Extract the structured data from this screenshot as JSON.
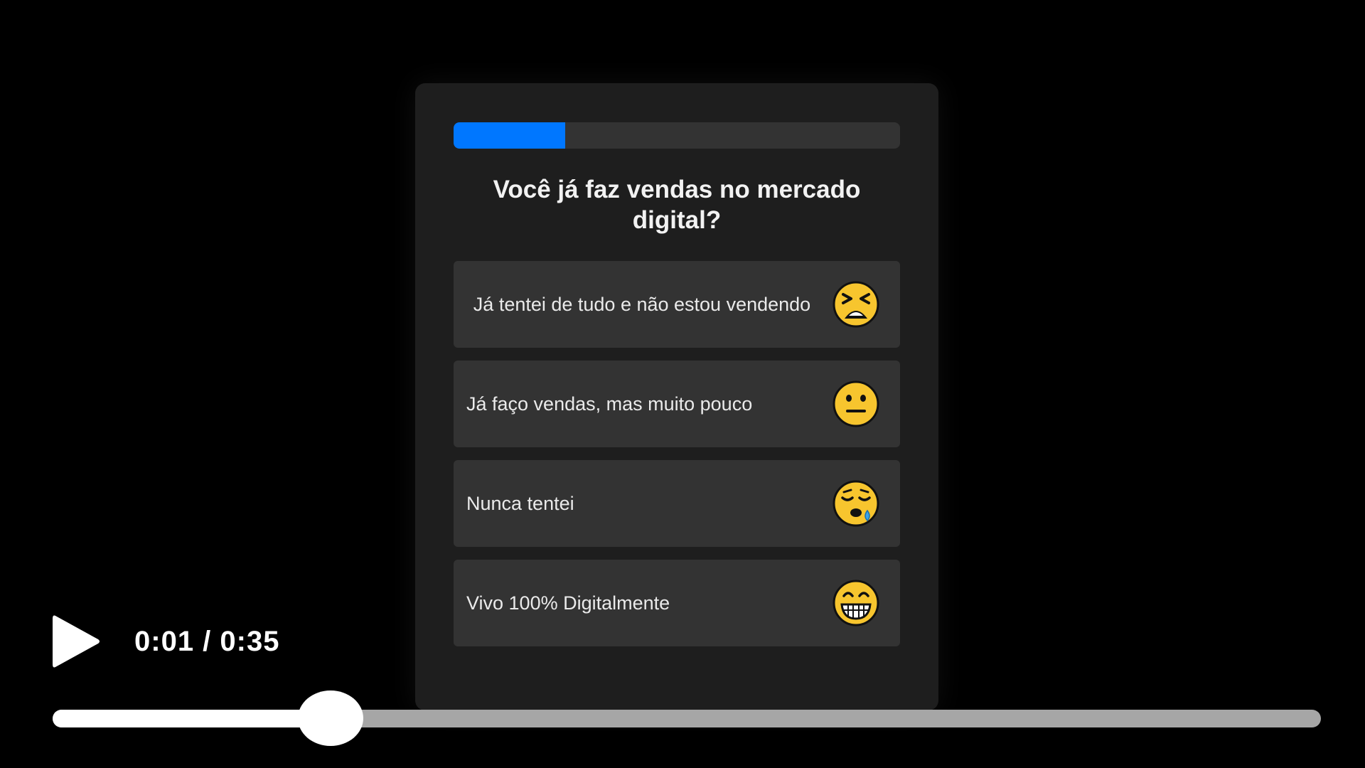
{
  "quiz": {
    "progress": 0.25,
    "progress_color": "#0077ff",
    "question": "Você já faz vendas no mercado digital?",
    "options": [
      {
        "label": "Já tentei de tudo e não estou vendendo",
        "icon": "tired-face-emoji-icon"
      },
      {
        "label": "Já faço vendas, mas muito pouco",
        "icon": "neutral-face-emoji-icon"
      },
      {
        "label": "Nunca tentei",
        "icon": "sleepy-face-emoji-icon"
      },
      {
        "label": "Vivo 100% Digitalmente",
        "icon": "grimacing-face-emoji-icon"
      }
    ]
  },
  "player": {
    "play_icon": "play-icon",
    "time": "0:01 / 0:35",
    "progress": 0.219
  }
}
